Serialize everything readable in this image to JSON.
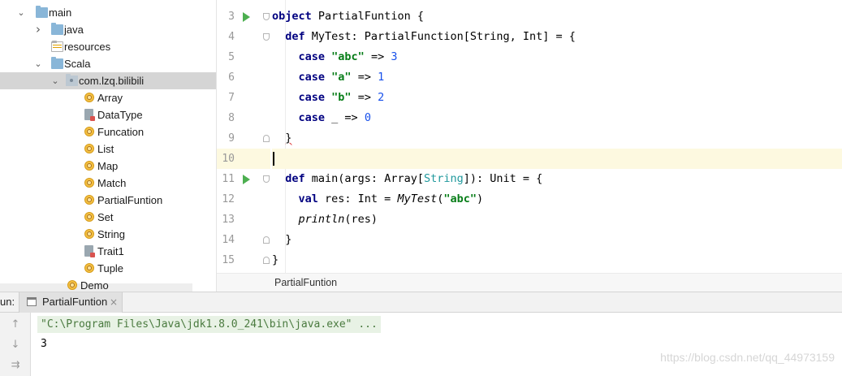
{
  "project_tree": {
    "items": [
      {
        "label": "main",
        "expanded": true,
        "icon": "folder-icon"
      },
      {
        "label": "java",
        "expanded": false,
        "icon": "folder-icon"
      },
      {
        "label": "resources",
        "icon": "resources-folder-icon"
      },
      {
        "label": "Scala",
        "expanded": true,
        "icon": "folder-icon"
      },
      {
        "label": "com.lzq.bilibili",
        "expanded": true,
        "icon": "package-icon",
        "selected": true
      },
      {
        "label": "Array",
        "icon": "scala-object-icon"
      },
      {
        "label": "DataType",
        "icon": "scala-file-icon"
      },
      {
        "label": "Funcation",
        "icon": "scala-object-icon"
      },
      {
        "label": "List",
        "icon": "scala-object-icon"
      },
      {
        "label": "Map",
        "icon": "scala-object-icon"
      },
      {
        "label": "Match",
        "icon": "scala-object-icon"
      },
      {
        "label": "PartialFuntion",
        "icon": "scala-object-icon"
      },
      {
        "label": "Set",
        "icon": "scala-object-icon"
      },
      {
        "label": "String",
        "icon": "scala-object-icon"
      },
      {
        "label": "Trait1",
        "icon": "scala-file-icon"
      },
      {
        "label": "Tuple",
        "icon": "scala-object-icon"
      },
      {
        "label": "Demo",
        "icon": "scala-object-icon"
      }
    ]
  },
  "editor": {
    "line_numbers": [
      "3",
      "4",
      "5",
      "6",
      "7",
      "8",
      "9",
      "10",
      "11",
      "12",
      "13",
      "14",
      "15"
    ],
    "current_line": "10",
    "lines": {
      "l3": {
        "kw": "object",
        "rest": " PartialFuntion {"
      },
      "l4": {
        "kw": "def",
        "rest": " MyTest: PartialFunction[String, Int] = {"
      },
      "l5": {
        "kw": "case",
        "str": "\"abc\"",
        "arrow": " => ",
        "num": "3"
      },
      "l6": {
        "kw": "case",
        "str": "\"a\"",
        "arrow": " => ",
        "num": "1"
      },
      "l7": {
        "kw": "case",
        "str": "\"b\"",
        "arrow": " => ",
        "num": "2"
      },
      "l8": {
        "kw": "case",
        "mid": " _ => ",
        "num": "0"
      },
      "l9": {
        "text": "}"
      },
      "l10": {
        "text": ""
      },
      "l11": {
        "kw": "def",
        "a": " main(args: Array[",
        "type": "String",
        "b": "]): Unit = {"
      },
      "l12": {
        "kw": "val",
        "a": " res: Int = ",
        "call": "MyTest",
        "b": "(",
        "str": "\"abc\"",
        "c": ")"
      },
      "l13": {
        "call": "println",
        "a": "(res)"
      },
      "l14": {
        "text": "}"
      },
      "l15": {
        "text": "}"
      }
    },
    "breadcrumb": "PartialFuntion"
  },
  "run_panel": {
    "title": "un:",
    "tab_label": "PartialFuntion",
    "tab_close": "×",
    "toolbar": [
      "up-arrow-icon",
      "down-arrow-icon",
      "soft-wrap-icon"
    ],
    "command": "\"C:\\Program Files\\Java\\jdk1.8.0_241\\bin\\java.exe\" ...",
    "output": "3"
  },
  "watermark": "https://blog.csdn.net/qq_44973159"
}
